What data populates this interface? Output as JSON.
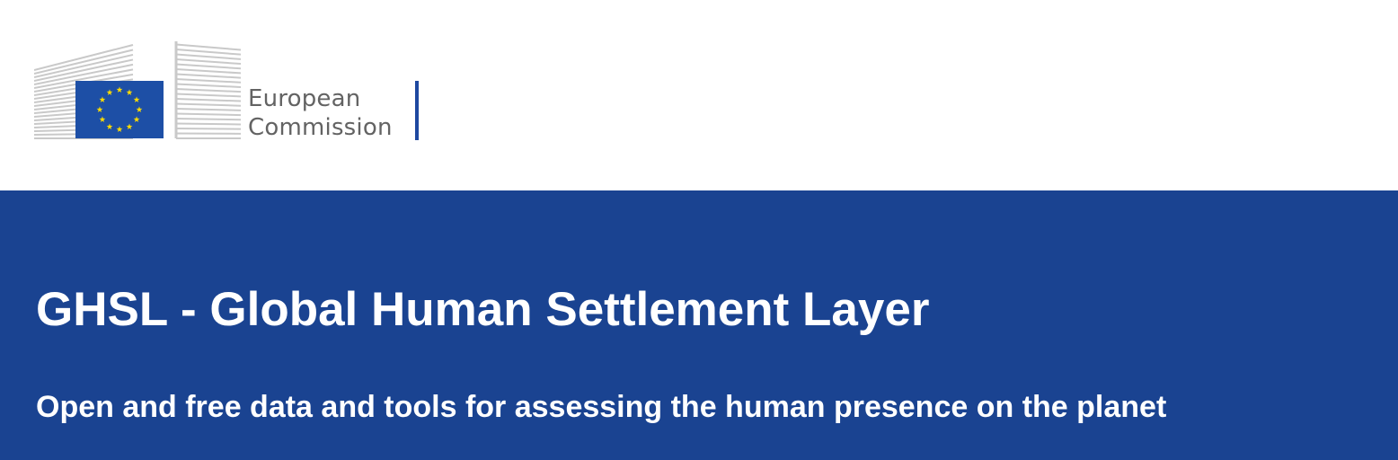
{
  "colors": {
    "eu_blue": "#1a4391",
    "flag_blue": "#1d4fa6",
    "star_yellow": "#ffdd00",
    "building_gray": "#c9c9c9",
    "logo_text_gray": "#636363",
    "divider_blue": "#1e48a0",
    "banner_text": "#ffffff"
  },
  "logo": {
    "line1": "European",
    "line2": "Commission",
    "icon": "european-commission-logo"
  },
  "banner": {
    "title": "GHSL - Global Human Settlement Layer",
    "subtitle": "Open and free data and tools for assessing the human presence on the planet"
  }
}
